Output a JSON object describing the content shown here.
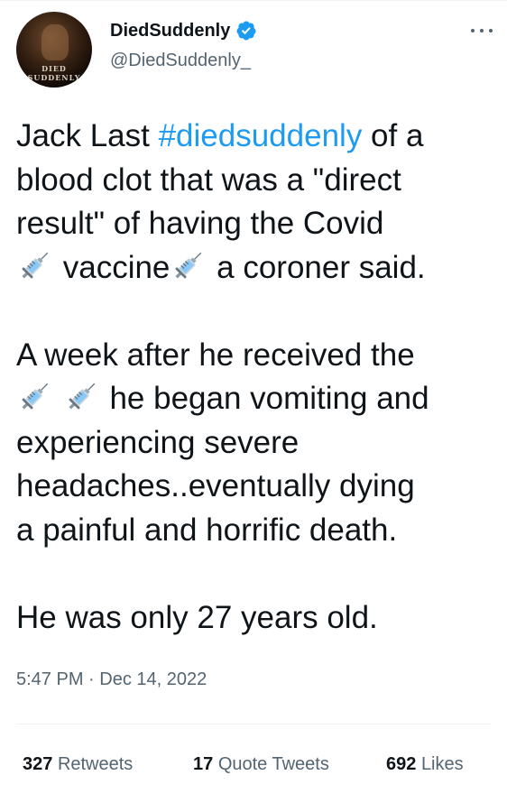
{
  "tweet": {
    "author": {
      "display_name": "DiedSuddenly",
      "handle": "@DiedSuddenly_",
      "verified": true,
      "avatar_text": "DIED SUDDENLY"
    },
    "text_segments": {
      "l1a": "Jack Last ",
      "hashtag": "#diedsuddenly",
      "l1b": " of a",
      "l2": "blood clot that was a \"direct",
      "l3": "result\" of having the Covid",
      "l4a": " vaccine",
      "l4b": " a coroner said.",
      "p2l1": "A week after he received the",
      "p2l2": " he began vomiting and",
      "p2l3": "experiencing severe",
      "p2l4": "headaches..eventually dying",
      "p2l5": "a painful and horrific death.",
      "p3": "He was only 27 years old."
    },
    "emoji_name": "syringe-emoji",
    "time": "5:47 PM",
    "separator": " · ",
    "date": "Dec 14, 2022",
    "stats": {
      "retweets_count": "327",
      "retweets_label": "Retweets",
      "quotes_count": "17",
      "quotes_label": "Quote Tweets",
      "likes_count": "692",
      "likes_label": "Likes"
    },
    "colors": {
      "text": "#0f1419",
      "secondary": "#536471",
      "accent": "#1d9bf0",
      "divider": "#eff3f4"
    }
  }
}
